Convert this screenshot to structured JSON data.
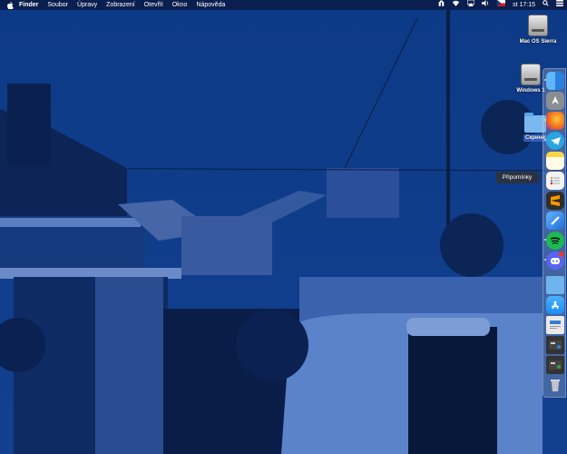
{
  "menubar": {
    "app_name": "Finder",
    "items": [
      "Soubor",
      "Úpravy",
      "Zobrazení",
      "Otevřít",
      "Okno",
      "Nápověda"
    ],
    "clock": "st 17:15",
    "icons": [
      "apple-logo-icon",
      "tor-icon",
      "wifi-icon",
      "airplay-icon",
      "volume-icon",
      "keyboard-flag-icon",
      "spotlight-icon",
      "control-center-icon"
    ]
  },
  "desktop": {
    "icons": [
      {
        "label": "Mac OS Sierra",
        "type": "hard-drive"
      },
      {
        "label": "Windows 1",
        "type": "hard-drive"
      },
      {
        "label": "Скрини",
        "type": "folder",
        "selected": true
      }
    ]
  },
  "dock": {
    "tooltip": "Připomínky",
    "items": [
      {
        "name": "finder",
        "icon": "finder-icon",
        "color": "#3d9ae8"
      },
      {
        "name": "launchpad",
        "icon": "launchpad-icon",
        "color": "#8a8d92"
      },
      {
        "name": "firefox",
        "icon": "firefox-icon",
        "color": "#f36c1b"
      },
      {
        "name": "telegram",
        "icon": "telegram-icon",
        "color": "#2aa3e0"
      },
      {
        "name": "notes",
        "icon": "notes-icon",
        "color": "#f8d648"
      },
      {
        "name": "reminders",
        "icon": "reminders-icon",
        "color": "#f3f3f3"
      },
      {
        "name": "sublime",
        "icon": "sublime-icon",
        "color": "#2e2e2e"
      },
      {
        "name": "xcode",
        "icon": "xcode-icon",
        "color": "#1f6fd6"
      },
      {
        "name": "spotify",
        "icon": "spotify-icon",
        "color": "#1db954"
      },
      {
        "name": "discord",
        "icon": "discord-icon",
        "color": "#5865f2"
      },
      {
        "name": "folder",
        "icon": "folder-icon",
        "color": "#6eb5ee"
      },
      {
        "name": "app-store",
        "icon": "app-store-icon",
        "color": "#1b8cf2"
      },
      {
        "name": "preview",
        "icon": "preview-icon",
        "color": "#e9e9e9"
      },
      {
        "name": "screenshot-1",
        "icon": "screenshot-thumb-icon",
        "color": "#333333"
      },
      {
        "name": "screenshot-2",
        "icon": "screenshot-thumb-icon",
        "color": "#333333"
      },
      {
        "name": "trash",
        "icon": "trash-icon",
        "color": "#c9ccd2"
      }
    ]
  }
}
